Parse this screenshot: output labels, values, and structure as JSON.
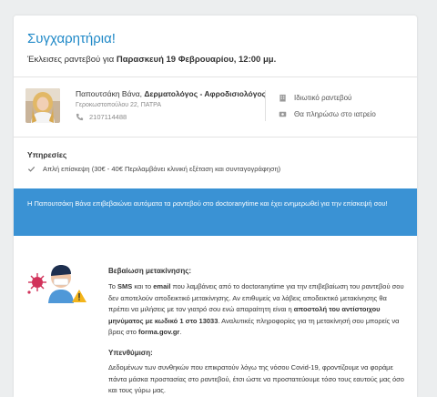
{
  "header": {
    "title": "Συγχαρητήρια!",
    "booked_prefix": "Έκλεισες ραντεβού για ",
    "booked_date": "Παρασκευή 19 Φεβρουαρίου, 12:00 μμ."
  },
  "doctor": {
    "name": "Παπουτσάκη Βάνα, ",
    "specialty": "Δερματολόγος - Αφροδισιολόγος",
    "address": "Γεροκωστοπούλου 22, ΠΑΤΡΑ",
    "phone": "2107114488"
  },
  "appointment_meta": {
    "type_label": "Ιδιωτικό ραντεβού",
    "payment_label": "Θα πληρώσω στο ιατρείο"
  },
  "services": {
    "title": "Υπηρεσίες",
    "items": [
      "Απλή επίσκεψη (30€ - 40€ Περιλαμβάνει κλινική εξέταση και συνταγογράφηση)"
    ]
  },
  "banner": {
    "text": "Η Παπουτσάκη Βάνα επιβεβαιώνει αυτόματα τα ραντεβού στο doctoranytime και έχει ενημερωθεί για την επίσκεψή σου!"
  },
  "confirmation": {
    "title": "Βεβαίωση μετακίνησης:",
    "p1": "Το ",
    "sms": "SMS",
    "p2": " και το ",
    "email": "email",
    "p3": " που λαμβάνεις από το doctoranytime για την επιβεβαίωση του ραντεβού σου δεν αποτελούν αποδεικτικό μετακίνησης. Αν επιθυμείς να λάβεις αποδεικτικό μετακίνησης θα πρέπει να μιλήσεις με τον γιατρό σου ενώ απαραίτητη είναι η ",
    "sms_code": "αποστολή του αντίστοιχου μηνύματος με κωδικό 1 στο 13033",
    "p4": ". Αναλυτικές πληροφορίες για τη μετακίνησή σου μπορείς να βρεις στο ",
    "site": "forma.gov.gr",
    "p5": "."
  },
  "reminder": {
    "title": "Υπενθύμιση:",
    "text": "Δεδομένων των συνθηκών που επικρατούν λόγω της νόσου Covid-19, φροντίζουμε να φοράμε πάντα μάσκα προστασίας στο ραντεβού, έτσι ώστε να προστατεύουμε τόσο τους εαυτούς μας όσο και τους γύρω μας."
  },
  "colors": {
    "accent": "#1e88c7",
    "banner": "#3a92d4",
    "page_bg": "#eceeef"
  },
  "icons": {
    "phone": "phone-icon",
    "building": "building-icon",
    "payment": "payment-icon",
    "check": "check-icon",
    "warning": "warning-icon",
    "virus": "virus-icon"
  }
}
